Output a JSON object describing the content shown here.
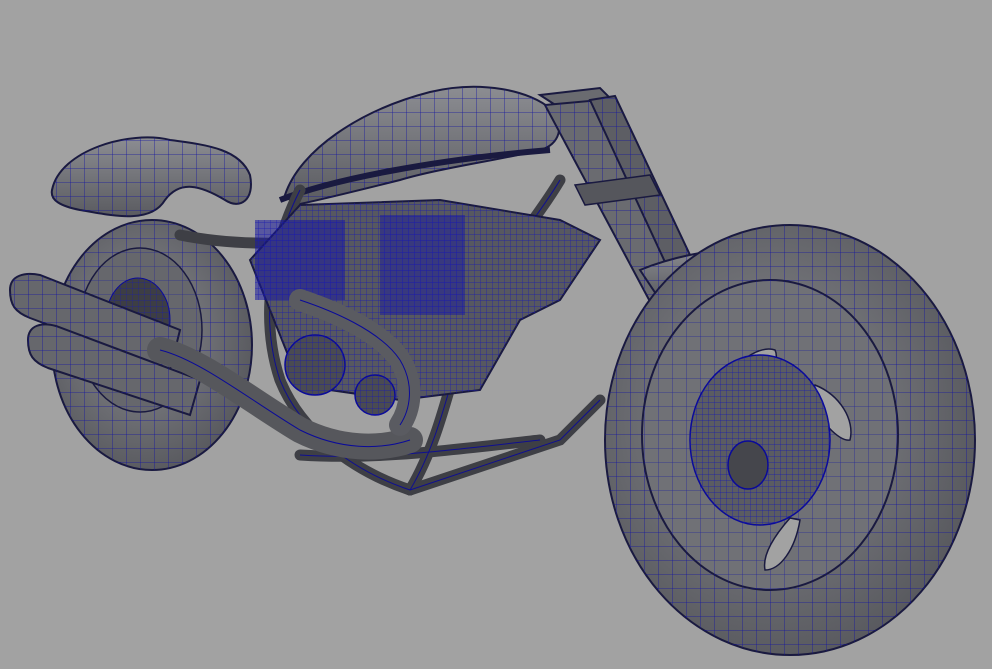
{
  "viewport": {
    "background": "#a2a2a2",
    "view": "perspective"
  },
  "model": {
    "subject": "motorcycle",
    "display_mode": "wireframe-on-shaded",
    "surface_color": "#6e6f73",
    "surface_dark": "#4c4d52",
    "surface_light": "#8c8d92",
    "wire_color": "#0a0a9a",
    "edge_color": "#1a1a40"
  }
}
